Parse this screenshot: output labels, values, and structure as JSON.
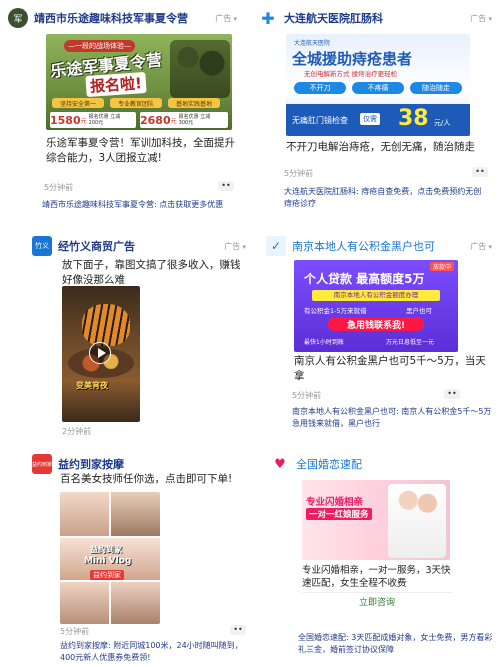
{
  "ad_label": "广告",
  "more_glyph": "••",
  "cards": [
    {
      "advertiser": "靖西市乐途趣味科技军事夏令营",
      "logo_text": "军",
      "creative": {
        "top_tag": "—一段的战场体验—",
        "headline": "乐途军事夏令营",
        "subline": "报名啦!",
        "features": [
          "坚持安全第一",
          "专业教官团队",
          "基地实践基地"
        ],
        "price_left": "1580",
        "price_left_unit": "元",
        "price_left_note": "报名优惠 立减200元",
        "price_right": "2680",
        "price_right_unit": "元",
        "price_right_note": "报名优惠 立减300元"
      },
      "body": "乐途军事夏令营！军训加科技，全面提升综合能力，3人团报立减!",
      "time": "5分钟前",
      "footer": "靖西市乐途趣味科技军事夏令营: 点击获取更多优惠"
    },
    {
      "advertiser": "大连航天医院肛肠科",
      "logo_text": "✚",
      "creative": {
        "tag": "大连航天医院",
        "headline": "全城援助痔疮患者",
        "subline": "无创电解新方式 揉痔治疗更轻松",
        "features": [
          "不开刀",
          "不疼痛",
          "随治随走"
        ],
        "price_label": "无痛肛门镜检查",
        "price_badge": "仅需",
        "price": "38",
        "price_unit": "元/人"
      },
      "body": "不开刀电解治痔疮，无创无痛，随治随走",
      "time": "5分钟前",
      "footer": "大连航天医院肛肠科: 痔疮自查免费，点击免费预约无创痔疮诊疗"
    },
    {
      "advertiser": "经竹义商贸广告",
      "logo_text": "竹义",
      "body": "放下面子，靠图文搞了很多收入，赚钱好像没那么难",
      "creative": {
        "caption": "变美宵夜"
      },
      "time": "2分钟前"
    },
    {
      "advertiser": "南京本地人有公积金黑户也可",
      "logo_text": "✓",
      "creative": {
        "corner": "放款中",
        "headline": "个人贷款 最高额度5万",
        "banner": "南京本地人有公积金额度办理",
        "row1": "有公积金1-5万来就借",
        "row2": "黑户也可",
        "cta": "急用钱联系我!",
        "line1": "最快1小时到账",
        "line2": "万元日息低至一元"
      },
      "body": "南京人有公积金黑户也可5千～5万，当天拿",
      "time": "5分钟前",
      "footer": "南京本地人有公积金黑户也可: 南京人有公积金5千～5万急用钱来就借，黑户也行"
    },
    {
      "advertiser": "益约到家按摩",
      "logo_text": "益约到家",
      "body": "百名美女技师任你选，点击即可下单!",
      "creative": {
        "overlay1": "益约到家",
        "overlay2": "Mini Vlog",
        "overlay3": "益约到家"
      },
      "time": "5分钟前",
      "footer": "益约到家按摩: 附近同城100米，24小时随叫随到，400元新人优惠券免费领!"
    },
    {
      "advertiser": "全国婚恋速配",
      "logo_text": "♥",
      "creative": {
        "headline1": "专业闪婚相亲",
        "headline2": "一对一红娘服务"
      },
      "body": "专业闪婚相亲，一对一服务，3天快速匹配，女生全程不收费",
      "cta": "立即咨询",
      "footer": "全国婚恋速配: 3天匹配成婚对象，女士免费，男方看彩礼三金，婚前签订协议保障"
    }
  ]
}
